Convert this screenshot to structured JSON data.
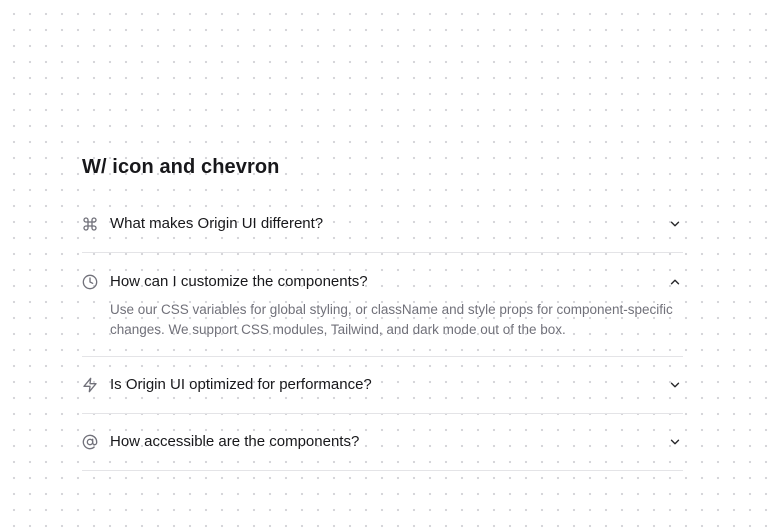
{
  "section": {
    "title": "W/ icon and chevron"
  },
  "accordion": {
    "items": [
      {
        "icon": "command-icon",
        "question": "What makes Origin UI different?",
        "expanded": false
      },
      {
        "icon": "clock-icon",
        "question": "How can I customize the components?",
        "expanded": true,
        "answer": "Use our CSS variables for global styling, or className and style props for component-specific changes. We support CSS modules, Tailwind, and dark mode out of the box."
      },
      {
        "icon": "zap-icon",
        "question": "Is Origin UI optimized for performance?",
        "expanded": false
      },
      {
        "icon": "at-sign-icon",
        "question": "How accessible are the components?",
        "expanded": false
      }
    ]
  },
  "colors": {
    "text": "#18181b",
    "muted": "#71717a",
    "border": "#e4e4e7",
    "dots": "#d4d4d8"
  }
}
